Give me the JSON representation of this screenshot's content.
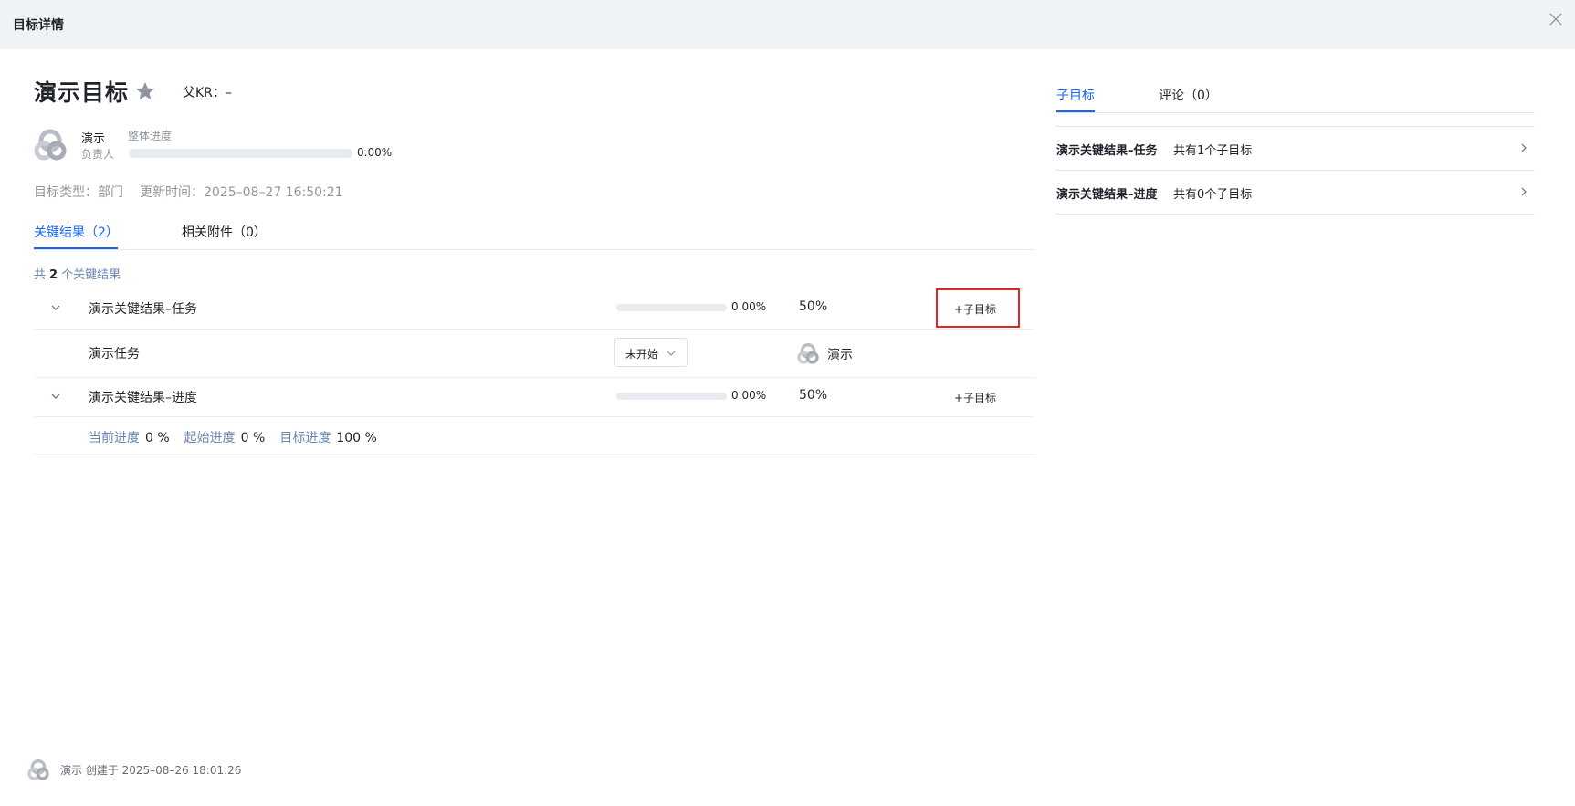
{
  "window": {
    "title": "目标详情"
  },
  "goal": {
    "title": "演示目标",
    "parent_kr": "父KR：–",
    "owner_name": "演示",
    "owner_role": "负责人",
    "overall_progress_label": "整体进度",
    "overall_progress_pct": "0.00%",
    "overall_progress_value": 0,
    "type_text": "目标类型：部门",
    "update_text": "更新时间：2025–08–27 16:50:21"
  },
  "left_tabs": [
    {
      "label": "关键结果（2）",
      "active": true
    },
    {
      "label": "相关附件（0）",
      "active": false
    }
  ],
  "kr_summary": {
    "prefix": "共",
    "count": "2",
    "suffix": "个关键结果"
  },
  "key_results": [
    {
      "name": "演示关键结果–任务",
      "progress_pct": "0.00%",
      "progress_value": 0,
      "weight": "50%",
      "add_label": "+子目标",
      "task": {
        "name": "演示任务",
        "status": "未开始",
        "owner": "演示"
      }
    },
    {
      "name": "演示关键结果–进度",
      "progress_pct": "0.00%",
      "progress_value": 0,
      "weight": "50%",
      "add_label": "+子目标",
      "detail": {
        "current_label": "当前进度",
        "current_value": "0 %",
        "start_label": "起始进度",
        "start_value": "0 %",
        "target_label": "目标进度",
        "target_value": "100 %"
      }
    }
  ],
  "right_tabs": [
    {
      "label": "子目标",
      "active": true
    },
    {
      "label": "评论（0）",
      "active": false
    }
  ],
  "sub_goals": [
    {
      "name": "演示关键结果–任务",
      "count_text": "共有1个子目标"
    },
    {
      "name": "演示关键结果–进度",
      "count_text": "共有0个子目标"
    }
  ],
  "footer": {
    "text": "演示 创建于 2025–08–26 18:01:26"
  },
  "colors": {
    "accent": "#1664ff",
    "highlight_border": "#e0242b",
    "muted_link": "#6b86b2"
  }
}
